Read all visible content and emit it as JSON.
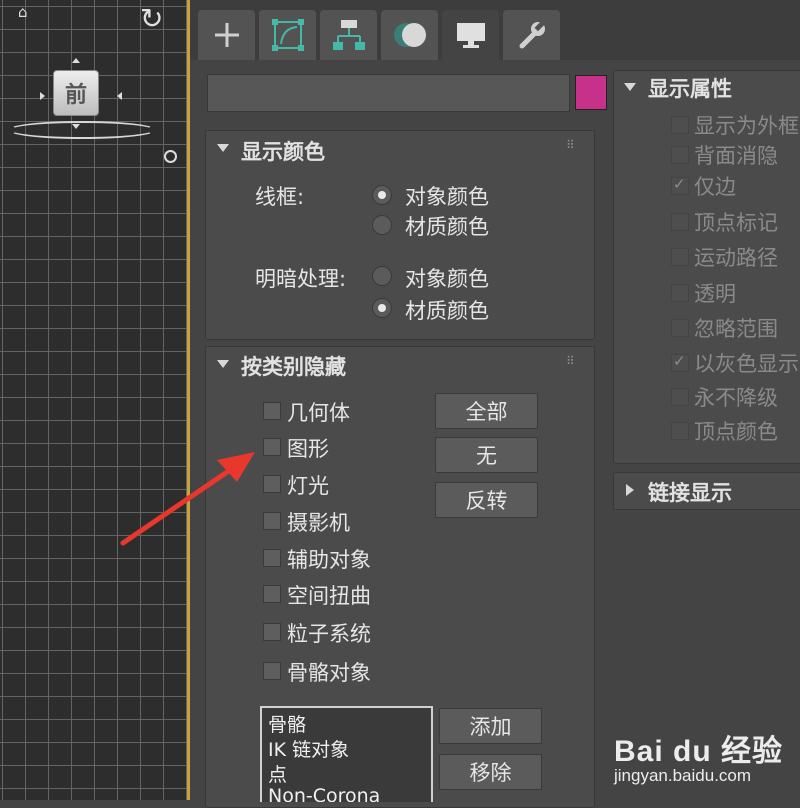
{
  "viewport": {
    "viewcube_label": "前"
  },
  "tabs": [
    {
      "name": "create",
      "icon": "plus-icon"
    },
    {
      "name": "modify",
      "icon": "modify-curve-icon"
    },
    {
      "name": "hierarchy",
      "icon": "hierarchy-icon"
    },
    {
      "name": "motion",
      "icon": "motion-circle-icon"
    },
    {
      "name": "display",
      "icon": "monitor-icon",
      "active": true
    },
    {
      "name": "utilities",
      "icon": "wrench-icon"
    }
  ],
  "object": {
    "name_value": "",
    "color": "#c8318a"
  },
  "display_color": {
    "title": "显示颜色",
    "wireframe_label": "线框:",
    "shaded_label": "明暗处理:",
    "wireframe_options": [
      "对象颜色",
      "材质颜色"
    ],
    "wireframe_selected": "对象颜色",
    "shaded_options": [
      "对象颜色",
      "材质颜色"
    ],
    "shaded_selected": "材质颜色"
  },
  "hide_by_category": {
    "title": "按类别隐藏",
    "categories": [
      {
        "label": "几何体",
        "checked": false
      },
      {
        "label": "图形",
        "checked": false
      },
      {
        "label": "灯光",
        "checked": false
      },
      {
        "label": "摄影机",
        "checked": false
      },
      {
        "label": "辅助对象",
        "checked": false
      },
      {
        "label": "空间扭曲",
        "checked": false
      },
      {
        "label": "粒子系统",
        "checked": false
      },
      {
        "label": "骨骼对象",
        "checked": false
      }
    ],
    "buttons": {
      "all": "全部",
      "none": "无",
      "invert": "反转",
      "add": "添加",
      "remove": "移除"
    },
    "list_items": [
      "骨骼",
      "IK 链对象",
      "点",
      "Non-Corona"
    ]
  },
  "display_properties": {
    "title": "显示属性",
    "items": [
      {
        "label": "显示为外框",
        "checked": false
      },
      {
        "label": "背面消隐",
        "checked": false
      },
      {
        "label": "仅边",
        "checked": true
      },
      {
        "label": "顶点标记",
        "checked": false
      },
      {
        "label": "运动路径",
        "checked": false
      },
      {
        "label": "透明",
        "checked": false
      },
      {
        "label": "忽略范围",
        "checked": false
      },
      {
        "label": "以灰色显示",
        "checked": true
      },
      {
        "label": "永不降级",
        "checked": false
      },
      {
        "label": "顶点颜色",
        "checked": false
      }
    ]
  },
  "link_display": {
    "title": "链接显示"
  },
  "annotation": {
    "arrow_color": "#e8372c"
  },
  "watermark": {
    "brand": "Bai du 经验",
    "url": "jingyan.baidu.com"
  }
}
